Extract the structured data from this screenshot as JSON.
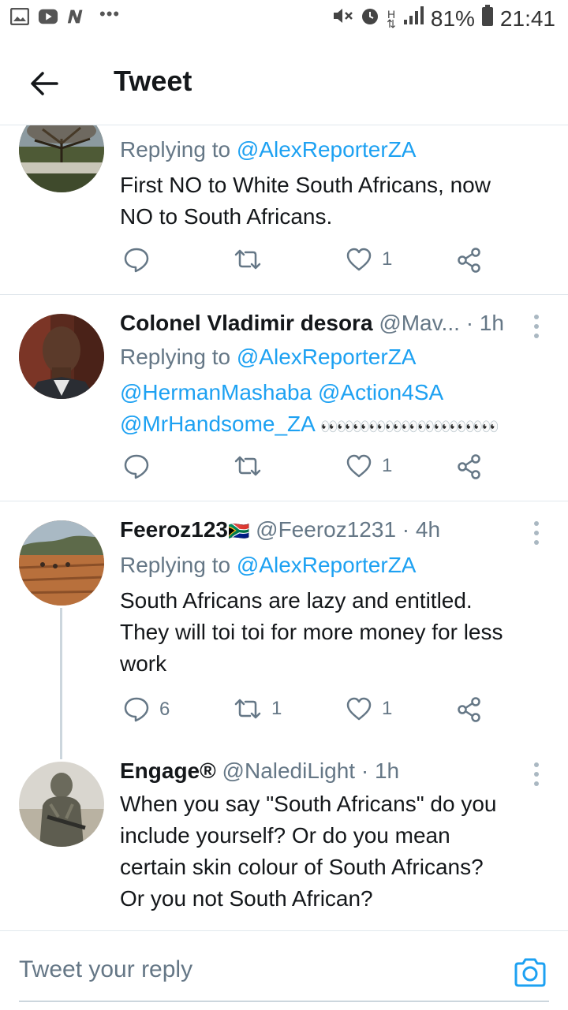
{
  "status_bar": {
    "battery": "81%",
    "time": "21:41",
    "network": "H"
  },
  "header": {
    "title": "Tweet"
  },
  "tweets": [
    {
      "replying_prefix": "Replying to",
      "replying_to": "@AlexReporterZA",
      "text_lines": [
        "First NO to White South Africans, now",
        "NO to South Africans."
      ],
      "likes": "1"
    },
    {
      "name": "Colonel Vladimir desora",
      "handle": "@Mav...",
      "time": "· 1h",
      "replying_prefix": "Replying to",
      "replying_to": "@AlexReporterZA",
      "mentions_line1": "@HermanMashaba @Action4SA",
      "mentions_line2": "@MrHandsome_ZA",
      "eyes": "👀👀👀👀👀👀👀👀👀👀👀",
      "likes": "1"
    },
    {
      "name": "Feeroz123",
      "flag": "🇿🇦",
      "handle": "@Feeroz1231",
      "time": "· 4h",
      "replying_prefix": "Replying to",
      "replying_to": "@AlexReporterZA",
      "text_lines": [
        "South Africans are lazy and entitled.",
        "They will toi toi for more money for less",
        "work"
      ],
      "replies": "6",
      "retweets": "1",
      "likes": "1"
    },
    {
      "name": "Engage®",
      "handle": "@NalediLight",
      "time": "· 1h",
      "text_lines": [
        "When you say \"South Africans\" do you",
        "include yourself? Or do you mean",
        "certain skin colour of South Africans?",
        "Or you not South African?"
      ]
    }
  ],
  "composer": {
    "placeholder": "Tweet your reply"
  }
}
